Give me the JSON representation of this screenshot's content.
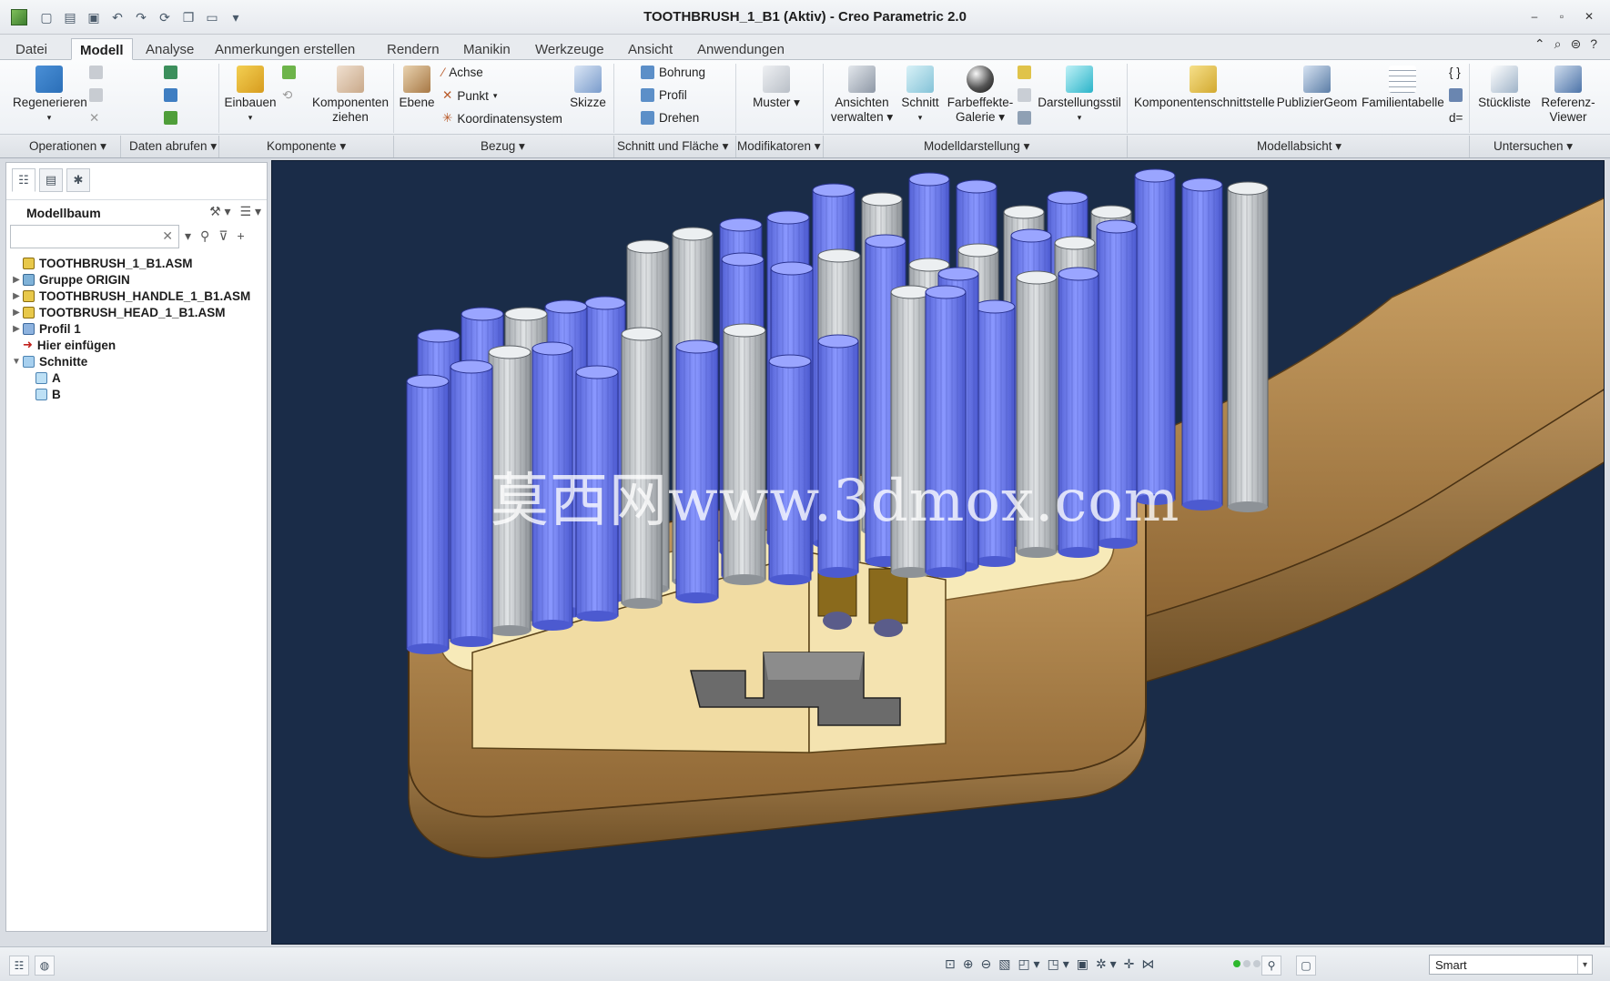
{
  "window": {
    "title": "TOOTHBRUSH_1_B1 (Aktiv) - Creo Parametric 2.0"
  },
  "tabs": [
    {
      "label": "Datei"
    },
    {
      "label": "Modell"
    },
    {
      "label": "Analyse"
    },
    {
      "label": "Anmerkungen erstellen"
    },
    {
      "label": "Rendern"
    },
    {
      "label": "Manikin"
    },
    {
      "label": "Werkzeuge"
    },
    {
      "label": "Ansicht"
    },
    {
      "label": "Anwendungen"
    }
  ],
  "ribbon": {
    "regenerieren": "Regenerieren",
    "einbauen": "Einbauen",
    "komponenten_line1": "Komponenten",
    "komponenten_line2": "ziehen",
    "ebene": "Ebene",
    "achse": "Achse",
    "punkt": "Punkt",
    "koordinatensystem": "Koordinatensystem",
    "skizze": "Skizze",
    "bohrung": "Bohrung",
    "profil": "Profil",
    "drehen": "Drehen",
    "muster": "Muster",
    "ansichten_line1": "Ansichten",
    "ansichten_line2": "verwalten",
    "schnitt": "Schnitt",
    "farbeffekte_line1": "Farbeffekte-",
    "farbeffekte_line2": "Galerie",
    "darstellungsstil": "Darstellungsstil",
    "komponentenschnittstelle": "Komponentenschnittstelle",
    "publiziergeom": "PublizierGeom",
    "familientabelle": "Familientabelle",
    "stueckliste": "Stückliste",
    "referenz_line1": "Referenz-",
    "referenz_line2": "Viewer",
    "d_eq": "d="
  },
  "groups": [
    {
      "label": "Operationen"
    },
    {
      "label": "Daten abrufen"
    },
    {
      "label": "Komponente"
    },
    {
      "label": "Bezug"
    },
    {
      "label": "Schnitt und Fläche"
    },
    {
      "label": "Modifikatoren"
    },
    {
      "label": "Modelldarstellung"
    },
    {
      "label": "Modellabsicht"
    },
    {
      "label": "Untersuchen"
    }
  ],
  "model_tree": {
    "title": "Modellbaum",
    "search_value": "",
    "nodes": [
      {
        "label": "TOOTHBRUSH_1_B1.ASM"
      },
      {
        "label": "Gruppe ORIGIN"
      },
      {
        "label": "TOOTHBRUSH_HANDLE_1_B1.ASM"
      },
      {
        "label": "TOOTBRUSH_HEAD_1_B1.ASM"
      },
      {
        "label": "Profil 1"
      },
      {
        "label": "Hier einfügen"
      },
      {
        "label": "Schnitte"
      },
      {
        "label": "A"
      },
      {
        "label": "B"
      }
    ]
  },
  "viewport": {
    "watermark": "莫西网www.3dmox.com",
    "colors": {
      "background": "#1a2c48",
      "bristle_blue": "#7484f2",
      "bristle_grey": "#c9cccf",
      "handle_brown": "#b38a52",
      "section_cream": "#f4e3b0",
      "insert_gold": "#8a6a1c"
    }
  },
  "status": {
    "filter_value": "Smart"
  }
}
